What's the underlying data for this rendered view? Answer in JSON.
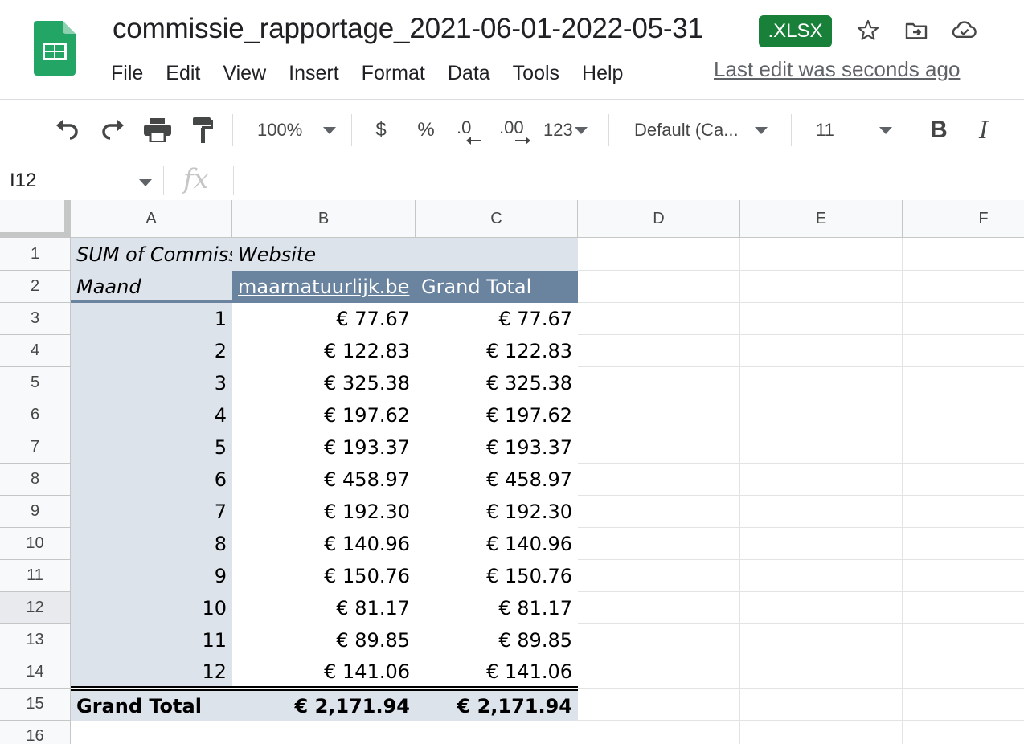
{
  "header": {
    "doc_title": "commissie_rapportage_2021-06-01-2022-05-31",
    "badge": ".XLSX",
    "icons": [
      "star-icon",
      "move-to-folder-icon",
      "cloud-saved-icon"
    ],
    "menu": [
      "File",
      "Edit",
      "View",
      "Insert",
      "Format",
      "Data",
      "Tools",
      "Help"
    ],
    "last_edit": "Last edit was seconds ago"
  },
  "toolbar": {
    "zoom": "100%",
    "currency": "$",
    "percent": "%",
    "dec_decrease": ".0",
    "dec_increase": ".00",
    "more_formats": "123",
    "font": "Default (Ca...",
    "font_size": "11",
    "bold": "B",
    "italic": "I"
  },
  "formula_bar": {
    "cell_ref": "I12",
    "fx": "fx",
    "content": ""
  },
  "sheet": {
    "columns": [
      "A",
      "B",
      "C",
      "D",
      "E",
      "F"
    ],
    "rows": [
      "1",
      "2",
      "3",
      "4",
      "5",
      "6",
      "7",
      "8",
      "9",
      "10",
      "11",
      "12",
      "13",
      "14",
      "15",
      "16"
    ],
    "selected_row": "12",
    "pivot": {
      "a1": "SUM of Commissie",
      "b1": "Website",
      "a2": "Maand",
      "b2": "maarnatuurlijk.be",
      "c2": "Grand Total",
      "data_rows": [
        {
          "month": "1",
          "site": "€ 77.67",
          "total": "€ 77.67"
        },
        {
          "month": "2",
          "site": "€ 122.83",
          "total": "€ 122.83"
        },
        {
          "month": "3",
          "site": "€ 325.38",
          "total": "€ 325.38"
        },
        {
          "month": "4",
          "site": "€ 197.62",
          "total": "€ 197.62"
        },
        {
          "month": "5",
          "site": "€ 193.37",
          "total": "€ 193.37"
        },
        {
          "month": "6",
          "site": "€ 458.97",
          "total": "€ 458.97"
        },
        {
          "month": "7",
          "site": "€ 192.30",
          "total": "€ 192.30"
        },
        {
          "month": "8",
          "site": "€ 140.96",
          "total": "€ 140.96"
        },
        {
          "month": "9",
          "site": "€ 150.76",
          "total": "€ 150.76"
        },
        {
          "month": "10",
          "site": "€ 81.17",
          "total": "€ 81.17"
        },
        {
          "month": "11",
          "site": "€ 89.85",
          "total": "€ 89.85"
        },
        {
          "month": "12",
          "site": "€ 141.06",
          "total": "€ 141.06"
        }
      ],
      "grand_total_label": "Grand Total",
      "grand_total_site": "€ 2,171.94",
      "grand_total_total": "€ 2,171.94"
    }
  },
  "colors": {
    "pivot_light": "#dde3eb",
    "pivot_dark": "#6a84a0",
    "badge_green": "#188038"
  }
}
